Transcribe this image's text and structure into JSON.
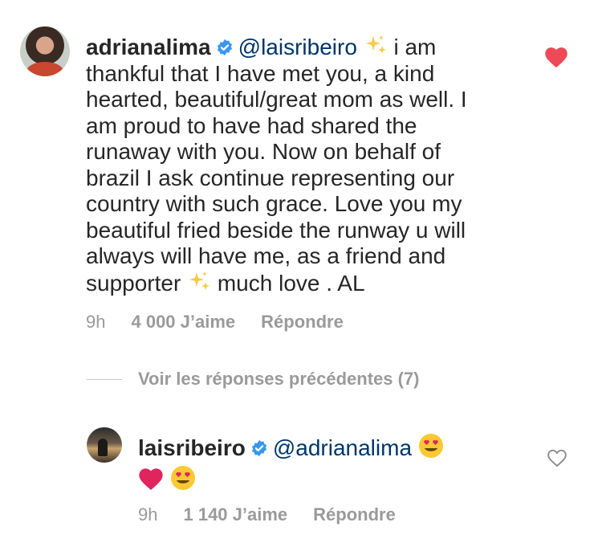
{
  "comment": {
    "username": "adrianalima",
    "mention": "@laisribeiro",
    "text_1": "i am thankful that I have met you, a kind hearted, beautiful/great mom as well. I am proud to have had shared the runaway with you. Now on behalf of brazil I ask continue representing our country with such grace. Love you my beautiful fried beside the runway u will always will have me, as a friend and supporter",
    "text_2": "much love . AL",
    "time": "9h",
    "likes": "4 000 J’aime",
    "reply_label": "Répondre",
    "liked": true
  },
  "view_previous_replies": "Voir les réponses précédentes (7)",
  "reply": {
    "username": "laisribeiro",
    "mention": "@adrianalima",
    "time": "9h",
    "likes": "1 140 J’aime",
    "reply_label": "Répondre",
    "liked": false
  },
  "colors": {
    "heart": "#ed4956",
    "verified": "#3897f0",
    "mention": "#003569",
    "meta": "#9a9a9a"
  },
  "icons": [
    "verified-badge-icon",
    "sparkles-icon",
    "heart-eyes-emoji",
    "red-heart-emoji",
    "heart-filled-icon",
    "heart-outline-icon"
  ]
}
